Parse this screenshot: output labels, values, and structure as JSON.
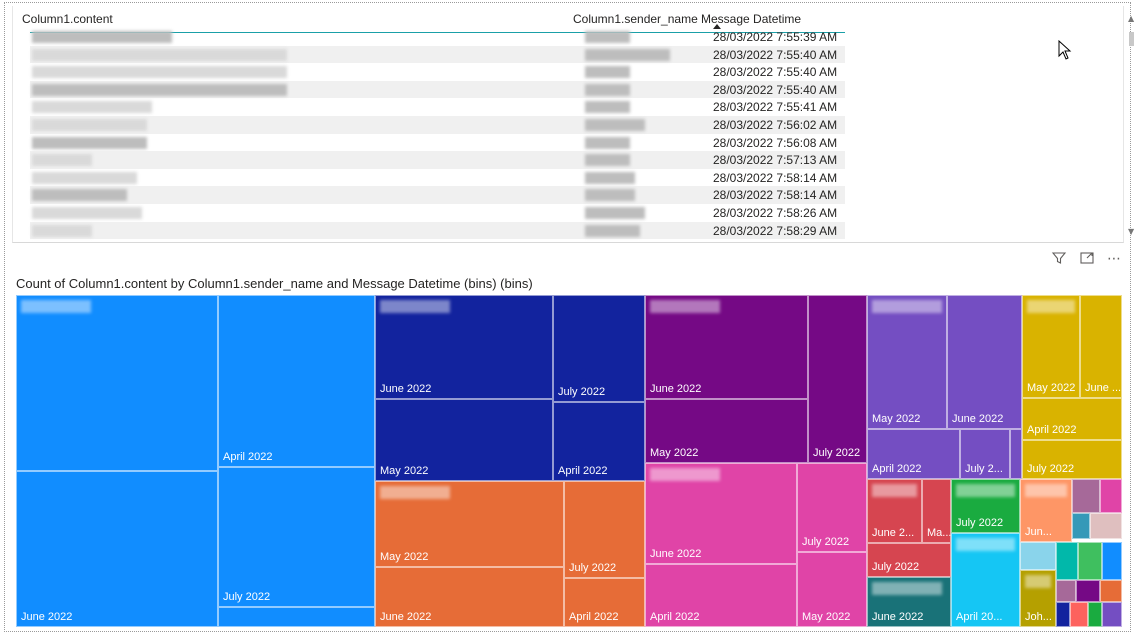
{
  "table": {
    "columns": [
      "Column1.content",
      "Column1.sender_name",
      "Message Datetime"
    ],
    "rows": [
      "28/03/2022 7:55:39 AM",
      "28/03/2022 7:55:40 AM",
      "28/03/2022 7:55:40 AM",
      "28/03/2022 7:55:40 AM",
      "28/03/2022 7:55:41 AM",
      "28/03/2022 7:56:02 AM",
      "28/03/2022 7:56:08 AM",
      "28/03/2022 7:57:13 AM",
      "28/03/2022 7:58:14 AM",
      "28/03/2022 7:58:14 AM",
      "28/03/2022 7:58:26 AM",
      "28/03/2022 7:58:29 AM"
    ]
  },
  "toolbar": {
    "filter_icon": "filter-icon",
    "focus_icon": "focus-mode-icon",
    "more_icon": "more-options-icon",
    "more_glyph": "⋯"
  },
  "chart": {
    "title": "Count of Column1.content by Column1.sender_name and Message Datetime (bins) (bins)"
  },
  "chart_data": {
    "type": "treemap",
    "title": "Count of Column1.content by Column1.sender_name and Message Datetime (bins) (bins)",
    "groups": [
      {
        "color": "#118dff",
        "cells": [
          "",
          "June 2022",
          "April 2022",
          "July 2022"
        ]
      },
      {
        "color": "#12239e",
        "cells": [
          "June 2022",
          "May 2022",
          "July 2022",
          "April 2022"
        ]
      },
      {
        "color": "#750985",
        "cells": [
          "June 2022",
          "May 2022",
          "July 2022"
        ]
      },
      {
        "color": "#744ec2",
        "cells": [
          "May 2022",
          "June 2022",
          "April 2022",
          "July 2..."
        ]
      },
      {
        "color": "#d9b300",
        "cells": [
          "May 2022",
          "June ...",
          "April 2022",
          "July 2022"
        ]
      },
      {
        "color": "#e66c37",
        "cells": [
          "May 2022",
          "June 2022",
          "July 2022",
          "April 2022"
        ]
      },
      {
        "color": "#e044a7",
        "cells": [
          "June 2022",
          "April 2022",
          "July 2022",
          "May 2022"
        ]
      },
      {
        "color": "#d64550",
        "cells": [
          "June 2...",
          "Ma...",
          "July 2022"
        ]
      },
      {
        "color": "#1aab40",
        "cells": [
          "July 2022"
        ]
      },
      {
        "color": "#197278",
        "cells": [
          "June 2022"
        ]
      },
      {
        "color": "#15c6f4",
        "cells": [
          "April 20..."
        ]
      },
      {
        "color": "#fe9666",
        "cells": [
          "Jun..."
        ]
      },
      {
        "color": "#b5a000",
        "cells": [
          "Joh..."
        ]
      }
    ]
  }
}
